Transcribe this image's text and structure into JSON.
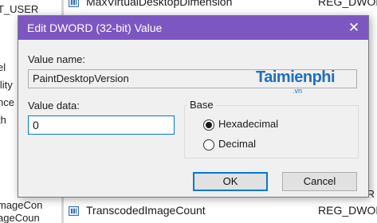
{
  "registry": {
    "tree_fragments": [
      "T_USER",
      "el",
      "ility",
      "nce",
      "th",
      "mageCon",
      "ageCoun"
    ],
    "rows": [
      {
        "name": "MaxVirtualDesktopDimension",
        "type": "REG_DWORD"
      },
      {
        "name": "TranscodedImageCount",
        "type": "REG_DWORD"
      }
    ],
    "side_fragments": [
      "R",
      "R",
      "T",
      "R",
      "AR"
    ]
  },
  "dialog": {
    "title": "Edit DWORD (32-bit) Value",
    "close_glyph": "✕",
    "value_name_label": "Value name:",
    "value_name": "PaintDesktopVersion",
    "value_data_label": "Value data:",
    "value_data": "0",
    "base_label": "Base",
    "base_options": [
      {
        "label": "Hexadecimal",
        "selected": true
      },
      {
        "label": "Decimal",
        "selected": false
      }
    ],
    "ok_label": "OK",
    "cancel_label": "Cancel"
  },
  "watermark": {
    "text": "Taimienphi",
    "sub": ".vn",
    "color": "#1f6fc0"
  },
  "colors": {
    "titlebar": "#7d57c1",
    "accent": "#0078d7",
    "dialog_bg": "#f0f0f0"
  }
}
